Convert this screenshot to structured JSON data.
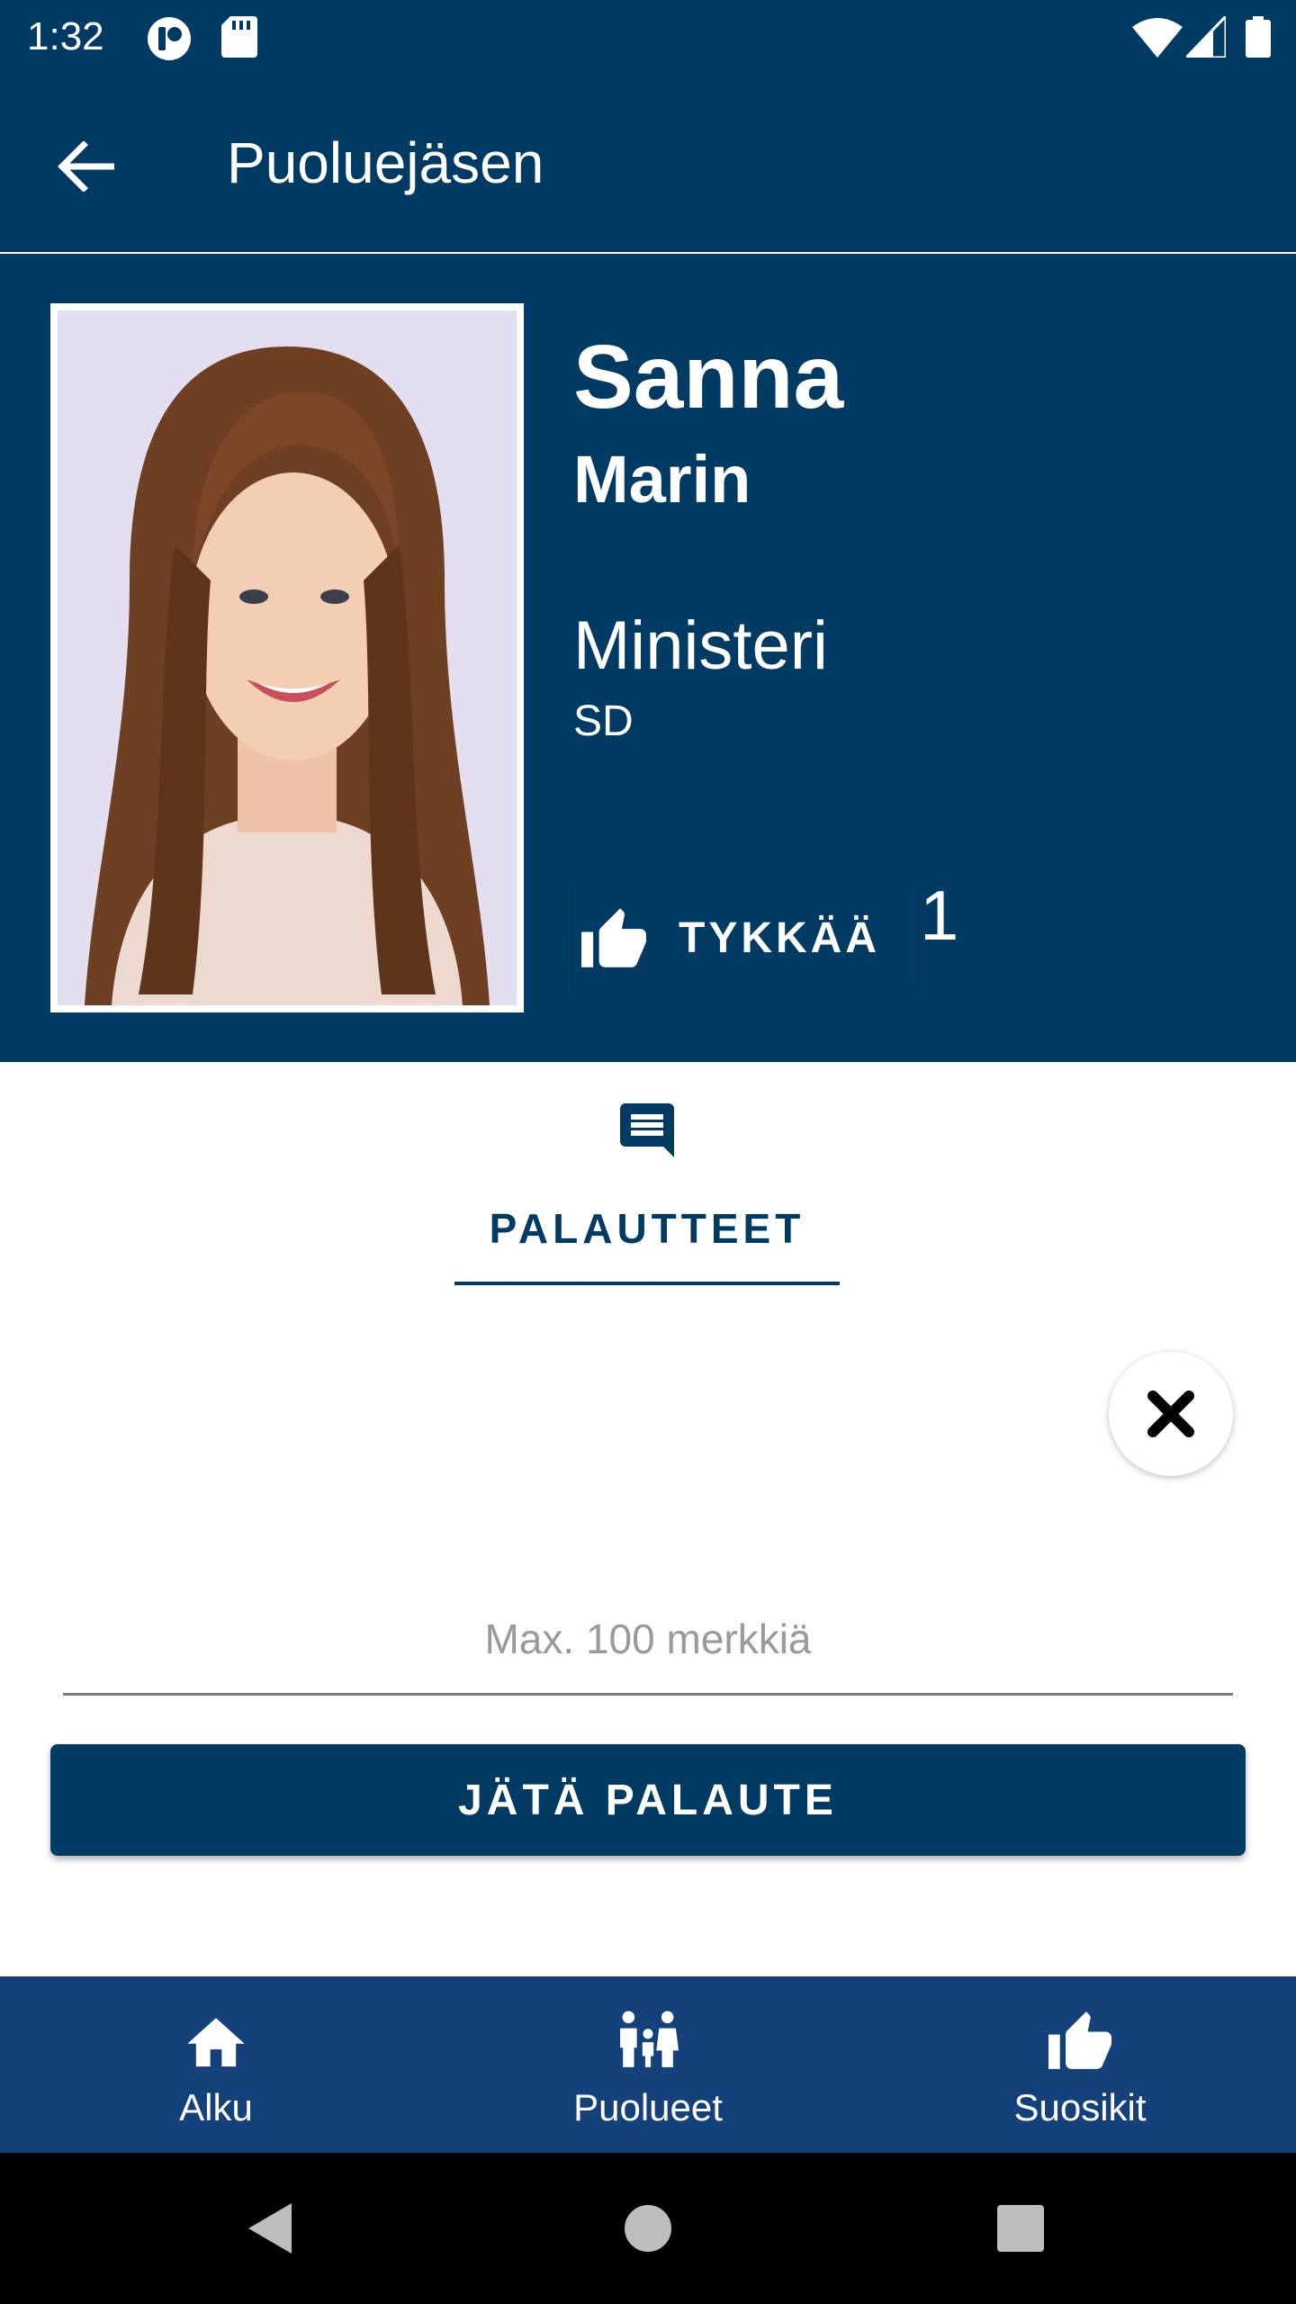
{
  "status_bar": {
    "time": "1:32",
    "icons": [
      "notification-app-icon",
      "sd-card-icon",
      "wifi-icon",
      "signal-icon",
      "battery-icon"
    ]
  },
  "app_bar": {
    "title": "Puoluejäsen",
    "back_icon": "arrow-back-icon"
  },
  "profile": {
    "first_name": "Sanna",
    "last_name": "Marin",
    "role": "Ministeri",
    "party": "SD",
    "like_label": "TYKKÄÄ",
    "like_icon": "thumb-up-icon",
    "like_count": "1",
    "photo_icon": "portrait-photo"
  },
  "tab": {
    "label": "PALAUTTEET",
    "icon": "comment-icon"
  },
  "feedback": {
    "placeholder": "Max. 100 merkkiä",
    "value": "",
    "close_icon": "close-icon",
    "submit_label": "JÄTÄ PALAUTE"
  },
  "bottom_nav": {
    "items": [
      {
        "label": "Alku",
        "icon": "home-icon"
      },
      {
        "label": "Puolueet",
        "icon": "people-icon"
      },
      {
        "label": "Suosikit",
        "icon": "thumb-up-icon"
      }
    ]
  },
  "system_nav": {
    "buttons": [
      "back-triangle-icon",
      "home-circle-icon",
      "recents-square-icon"
    ]
  },
  "colors": {
    "primary": "#013a63",
    "nav_background": "#15417a",
    "white": "#ffffff"
  }
}
